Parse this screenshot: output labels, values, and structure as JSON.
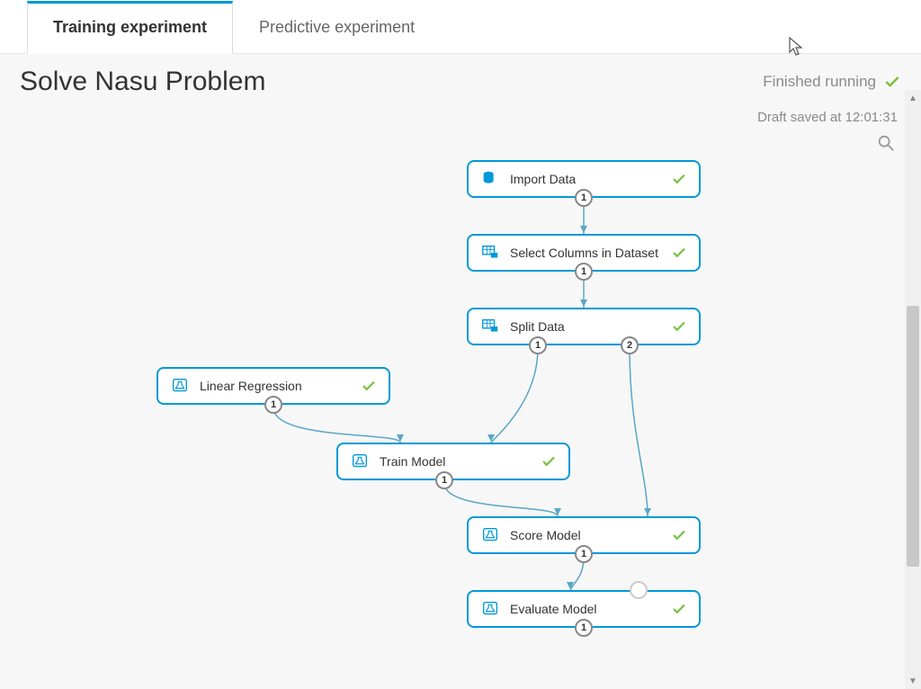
{
  "tabs": [
    {
      "label": "Training experiment",
      "active": true
    },
    {
      "label": "Predictive experiment",
      "active": false
    }
  ],
  "title": "Solve Nasu Problem",
  "status_text": "Finished running",
  "draft_text": "Draft saved at 12:01:31",
  "nodes": {
    "import": {
      "label": "Import Data",
      "icon": "db",
      "ports": [
        "1"
      ]
    },
    "select": {
      "label": "Select Columns in Dataset",
      "icon": "grid",
      "ports": [
        "1"
      ]
    },
    "split": {
      "label": "Split Data",
      "icon": "grid",
      "ports": [
        "1",
        "2"
      ]
    },
    "linreg": {
      "label": "Linear Regression",
      "icon": "flask",
      "ports": [
        "1"
      ]
    },
    "train": {
      "label": "Train Model",
      "icon": "flask",
      "ports": [
        "1"
      ]
    },
    "score": {
      "label": "Score Model",
      "icon": "flask",
      "ports": [
        "1"
      ]
    },
    "evaluate": {
      "label": "Evaluate Model",
      "icon": "flask",
      "ports": [
        "1"
      ]
    }
  },
  "colors": {
    "accent": "#0099d8",
    "ok": "#7ac142"
  }
}
